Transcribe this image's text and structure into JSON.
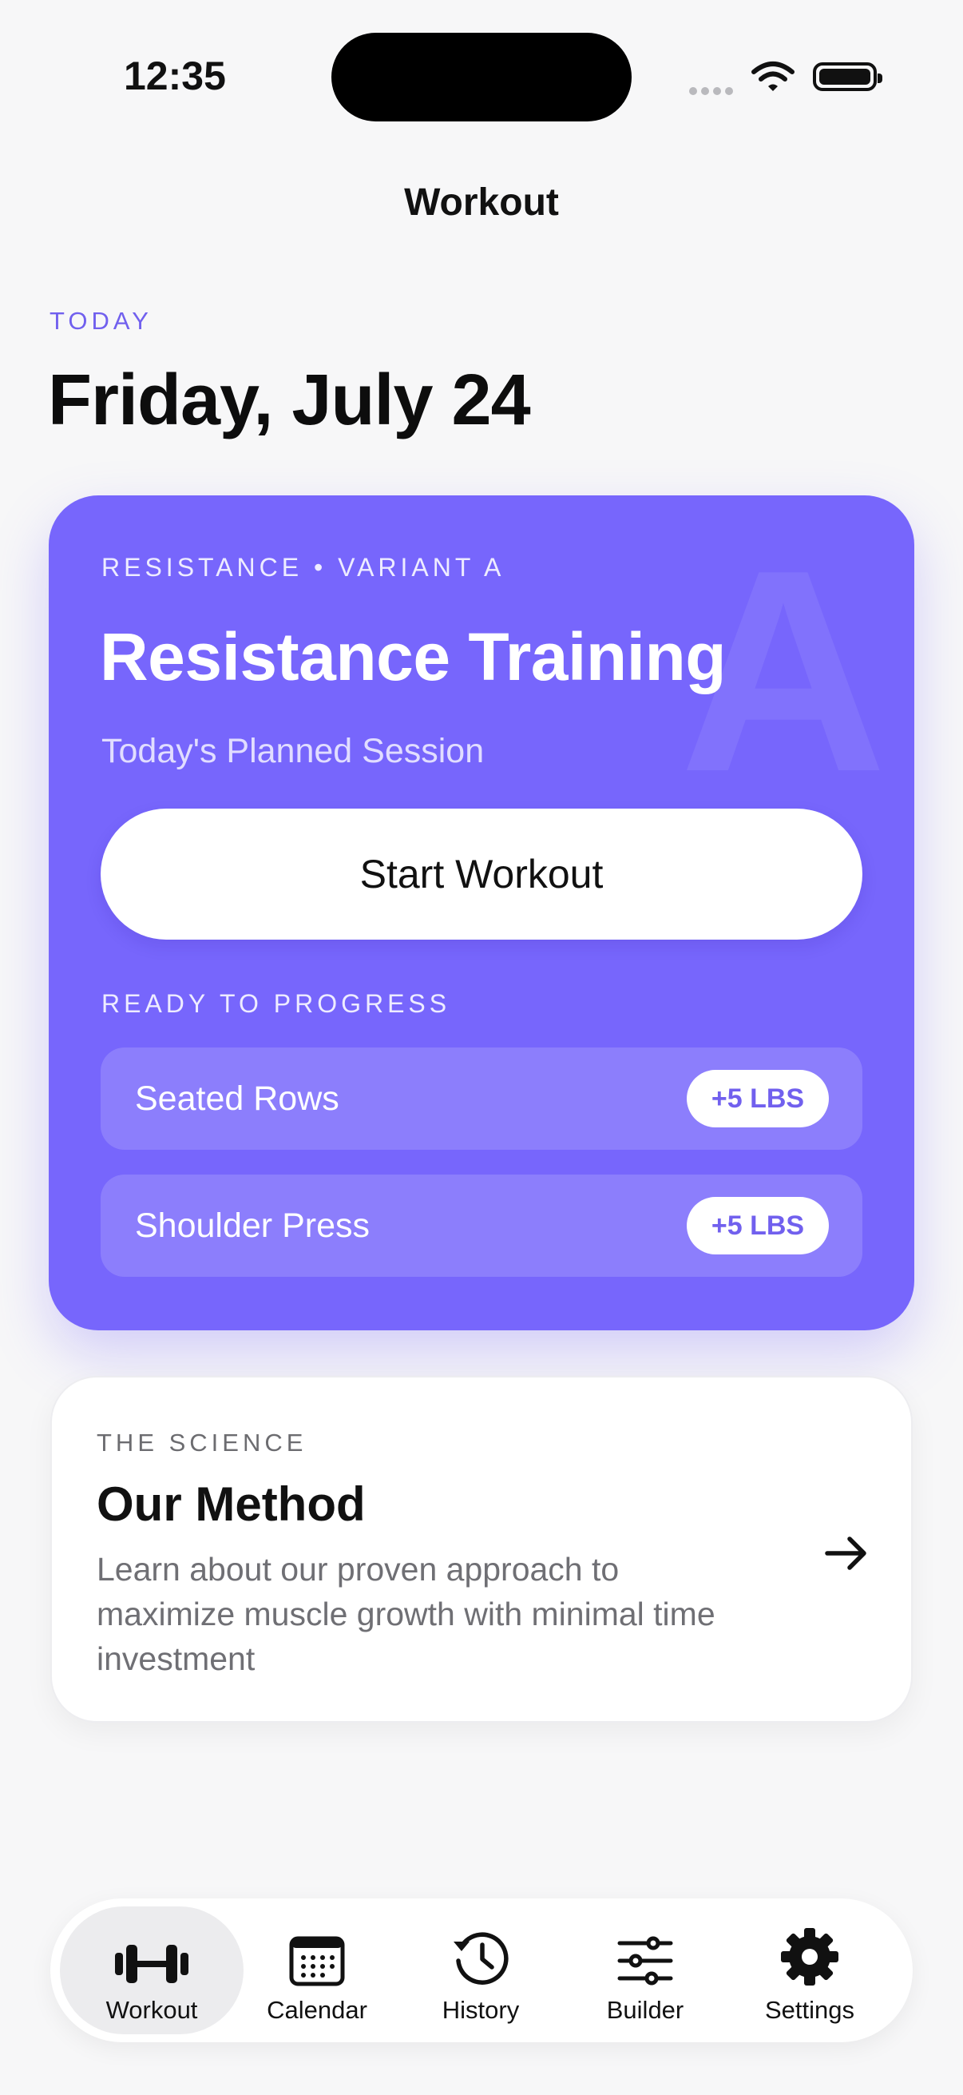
{
  "status_bar": {
    "time": "12:35"
  },
  "nav": {
    "title": "Workout"
  },
  "header": {
    "today_label": "TODAY",
    "date": "Friday, July 24"
  },
  "workout_card": {
    "kicker": "RESISTANCE • VARIANT A",
    "watermark": "A",
    "title": "Resistance Training",
    "subtitle": "Today's Planned Session",
    "start_button": "Start Workout",
    "ready_label": "READY TO PROGRESS",
    "progressions": [
      {
        "name": "Seated Rows",
        "badge": "+5 LBS"
      },
      {
        "name": "Shoulder Press",
        "badge": "+5 LBS"
      }
    ],
    "accent_color": "#7766fc"
  },
  "method_card": {
    "kicker": "THE SCIENCE",
    "title": "Our Method",
    "description": "Learn about our proven approach to maximize muscle growth with minimal time investment"
  },
  "tabbar": {
    "tabs": [
      {
        "label": "Workout",
        "icon": "dumbbell-icon",
        "active": true
      },
      {
        "label": "Calendar",
        "icon": "calendar-icon",
        "active": false
      },
      {
        "label": "History",
        "icon": "history-icon",
        "active": false
      },
      {
        "label": "Builder",
        "icon": "sliders-icon",
        "active": false
      },
      {
        "label": "Settings",
        "icon": "gear-icon",
        "active": false
      }
    ]
  }
}
